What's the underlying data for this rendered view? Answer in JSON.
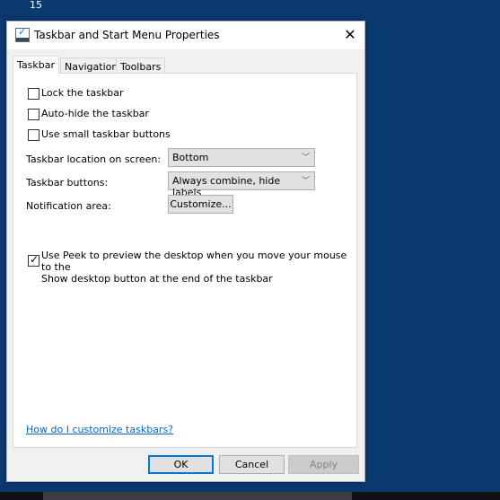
{
  "desktop": {
    "clock_fragment": "15"
  },
  "dialog": {
    "title": "Taskbar and Start Menu Properties",
    "tabs": [
      {
        "label": "Taskbar",
        "active": true
      },
      {
        "label": "Navigation",
        "active": false
      },
      {
        "label": "Toolbars",
        "active": false
      }
    ],
    "checkboxes": [
      {
        "label": "Lock the taskbar",
        "checked": false
      },
      {
        "label": "Auto-hide the taskbar",
        "checked": false
      },
      {
        "label": "Use small taskbar buttons",
        "checked": false
      }
    ],
    "location_label": "Taskbar location on screen:",
    "location_value": "Bottom",
    "buttons_label": "Taskbar buttons:",
    "buttons_value": "Always combine, hide labels",
    "notification_label": "Notification area:",
    "customize_label": "Customize...",
    "peek": {
      "line1": "Use Peek to preview the desktop when you move your mouse to the",
      "line2": "Show desktop button at the end of the taskbar",
      "checked": true
    },
    "help_link": "How do I customize taskbars?",
    "ok": "OK",
    "cancel": "Cancel",
    "apply": "Apply"
  },
  "colors": {
    "desktop": "#0b3a72",
    "accent": "#0078d7",
    "link": "#0066cc"
  }
}
